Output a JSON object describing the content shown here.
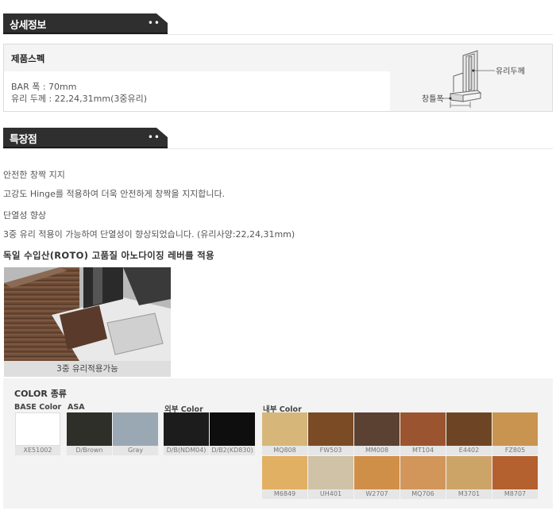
{
  "detail": {
    "heading": "상세정보",
    "dots": "••"
  },
  "spec": {
    "title": "제품스펙",
    "bar_width": "BAR 폭 : 70mm",
    "glass": "유리 두께 : 22,24,31mm(3중유리)",
    "diagram_glass_label": "유리두께",
    "diagram_frame_label": "창틀폭"
  },
  "features": {
    "heading": "특장점",
    "dots": "••",
    "items": [
      "안전한 창짝 지지",
      "고강도 Hinge를 적용하여 더욱 안전하게 창짝을 지지합니다.",
      "단열성 향상",
      "3중 유리 적용이 가능하여 단열성이 향상되었습니다. (유리사양:22,24,31mm)",
      "독일 수입산(ROTO) 고품질 아노다이징 레버를 적용"
    ],
    "photo_caption": "3중 유리적용가능"
  },
  "colors": {
    "title": "COLOR 종류",
    "groups": {
      "base": "BASE Color",
      "asa": "ASA",
      "outer": "외부 Color",
      "inner": "내부 Color"
    },
    "base": [
      {
        "name": "XE51002",
        "hex": "#ffffff"
      }
    ],
    "asa": [
      {
        "name": "D/Brown",
        "hex": "#2d2f28"
      },
      {
        "name": "Gray",
        "hex": "#9aa8b4"
      }
    ],
    "outer": [
      {
        "name": "D/B(NDM04)",
        "hex": "#1c1c1c"
      },
      {
        "name": "D/B2(KD830)",
        "hex": "#0e0e0e"
      }
    ],
    "inner_row1": [
      {
        "name": "MQ808",
        "hex": "#d7b67a"
      },
      {
        "name": "FW503",
        "hex": "#7a4b25"
      },
      {
        "name": "MM008",
        "hex": "#5a4132"
      },
      {
        "name": "MT104",
        "hex": "#9a5530"
      },
      {
        "name": "E4402",
        "hex": "#6e4524"
      },
      {
        "name": "FZ805",
        "hex": "#c9944f"
      }
    ],
    "inner_row2": [
      {
        "name": "M6849",
        "hex": "#e2b063"
      },
      {
        "name": "UH401",
        "hex": "#cfc2a6"
      },
      {
        "name": "W2707",
        "hex": "#d08f48"
      },
      {
        "name": "MQ706",
        "hex": "#d2965a"
      },
      {
        "name": "M3701",
        "hex": "#cda468"
      },
      {
        "name": "M8707",
        "hex": "#b5602f"
      }
    ]
  }
}
